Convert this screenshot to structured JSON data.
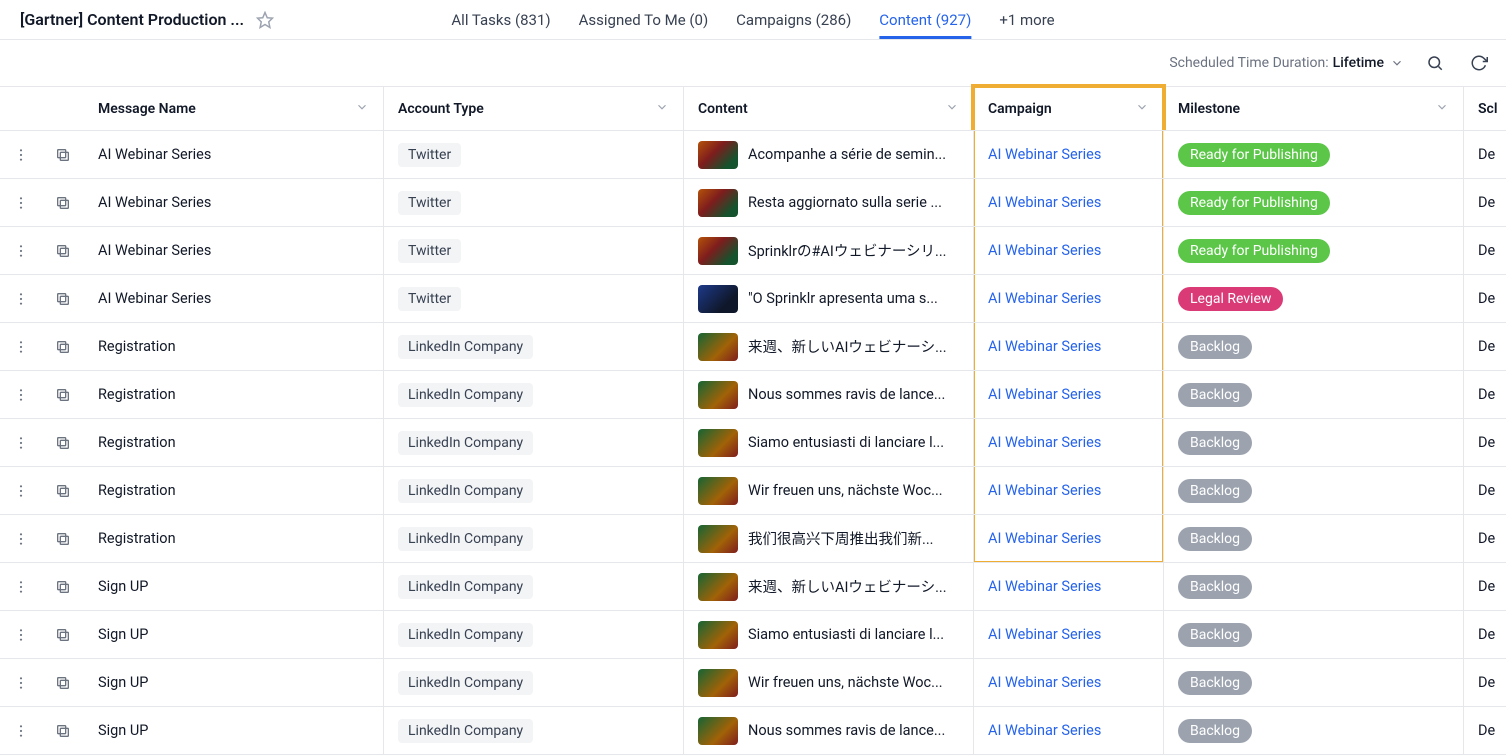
{
  "header": {
    "title": "[Gartner] Content Production ..."
  },
  "tabs": [
    {
      "label": "All Tasks (831)",
      "active": false
    },
    {
      "label": "Assigned To Me (0)",
      "active": false
    },
    {
      "label": "Campaigns (286)",
      "active": false
    },
    {
      "label": "Content (927)",
      "active": true
    },
    {
      "label": "+1 more",
      "active": false
    }
  ],
  "toolbar": {
    "duration_label": "Scheduled Time Duration:",
    "duration_value": "Lifetime"
  },
  "columns": {
    "message_name": "Message Name",
    "account_type": "Account Type",
    "content": "Content",
    "campaign": "Campaign",
    "milestone": "Milestone",
    "last": "Scl"
  },
  "milestones": {
    "ready": "Ready for Publishing",
    "legal": "Legal Review",
    "backlog": "Backlog"
  },
  "rows": [
    {
      "message": "AI Webinar Series",
      "account": "Twitter",
      "content": "Acompanhe a série de semin...",
      "thumb": "a",
      "campaign": "AI Webinar Series",
      "milestone": "ready",
      "hl": true,
      "last": "De"
    },
    {
      "message": "AI Webinar Series",
      "account": "Twitter",
      "content": "Resta aggiornato sulla serie ...",
      "thumb": "a",
      "campaign": "AI Webinar Series",
      "milestone": "ready",
      "hl": true,
      "last": "De"
    },
    {
      "message": "AI Webinar Series",
      "account": "Twitter",
      "content": "Sprinklrの#AIウェビナーシリ...",
      "thumb": "a",
      "campaign": "AI Webinar Series",
      "milestone": "ready",
      "hl": true,
      "last": "De"
    },
    {
      "message": "AI Webinar Series",
      "account": "Twitter",
      "content": "\"O Sprinklr apresenta uma s...",
      "thumb": "b",
      "campaign": "AI Webinar Series",
      "milestone": "legal",
      "hl": true,
      "last": "De"
    },
    {
      "message": "Registration",
      "account": "LinkedIn Company",
      "content": "来週、新しいAIウェビナーシ...",
      "thumb": "c",
      "campaign": "AI Webinar Series",
      "milestone": "backlog",
      "hl": true,
      "last": "De"
    },
    {
      "message": "Registration",
      "account": "LinkedIn Company",
      "content": "Nous sommes ravis de lance...",
      "thumb": "c",
      "campaign": "AI Webinar Series",
      "milestone": "backlog",
      "hl": true,
      "last": "De"
    },
    {
      "message": "Registration",
      "account": "LinkedIn Company",
      "content": "Siamo entusiasti di lanciare l...",
      "thumb": "c",
      "campaign": "AI Webinar Series",
      "milestone": "backlog",
      "hl": true,
      "last": "De"
    },
    {
      "message": "Registration",
      "account": "LinkedIn Company",
      "content": "Wir freuen uns, nächste Woc...",
      "thumb": "c",
      "campaign": "AI Webinar Series",
      "milestone": "backlog",
      "hl": true,
      "last": "De"
    },
    {
      "message": "Registration",
      "account": "LinkedIn Company",
      "content": "我们很高兴下周推出我们新...",
      "thumb": "c",
      "campaign": "AI Webinar Series",
      "milestone": "backlog",
      "hl": true,
      "hlLast": true,
      "last": "De"
    },
    {
      "message": "Sign UP",
      "account": "LinkedIn Company",
      "content": "来週、新しいAIウェビナーシ...",
      "thumb": "c",
      "campaign": "AI Webinar Series",
      "milestone": "backlog",
      "hl": false,
      "last": "De"
    },
    {
      "message": "Sign UP",
      "account": "LinkedIn Company",
      "content": "Siamo entusiasti di lanciare l...",
      "thumb": "c",
      "campaign": "AI Webinar Series",
      "milestone": "backlog",
      "hl": false,
      "last": "De"
    },
    {
      "message": "Sign UP",
      "account": "LinkedIn Company",
      "content": "Wir freuen uns, nächste Woc...",
      "thumb": "c",
      "campaign": "AI Webinar Series",
      "milestone": "backlog",
      "hl": false,
      "last": "De"
    },
    {
      "message": "Sign UP",
      "account": "LinkedIn Company",
      "content": "Nous sommes ravis de lance...",
      "thumb": "c",
      "campaign": "AI Webinar Series",
      "milestone": "backlog",
      "hl": false,
      "last": "De"
    }
  ]
}
